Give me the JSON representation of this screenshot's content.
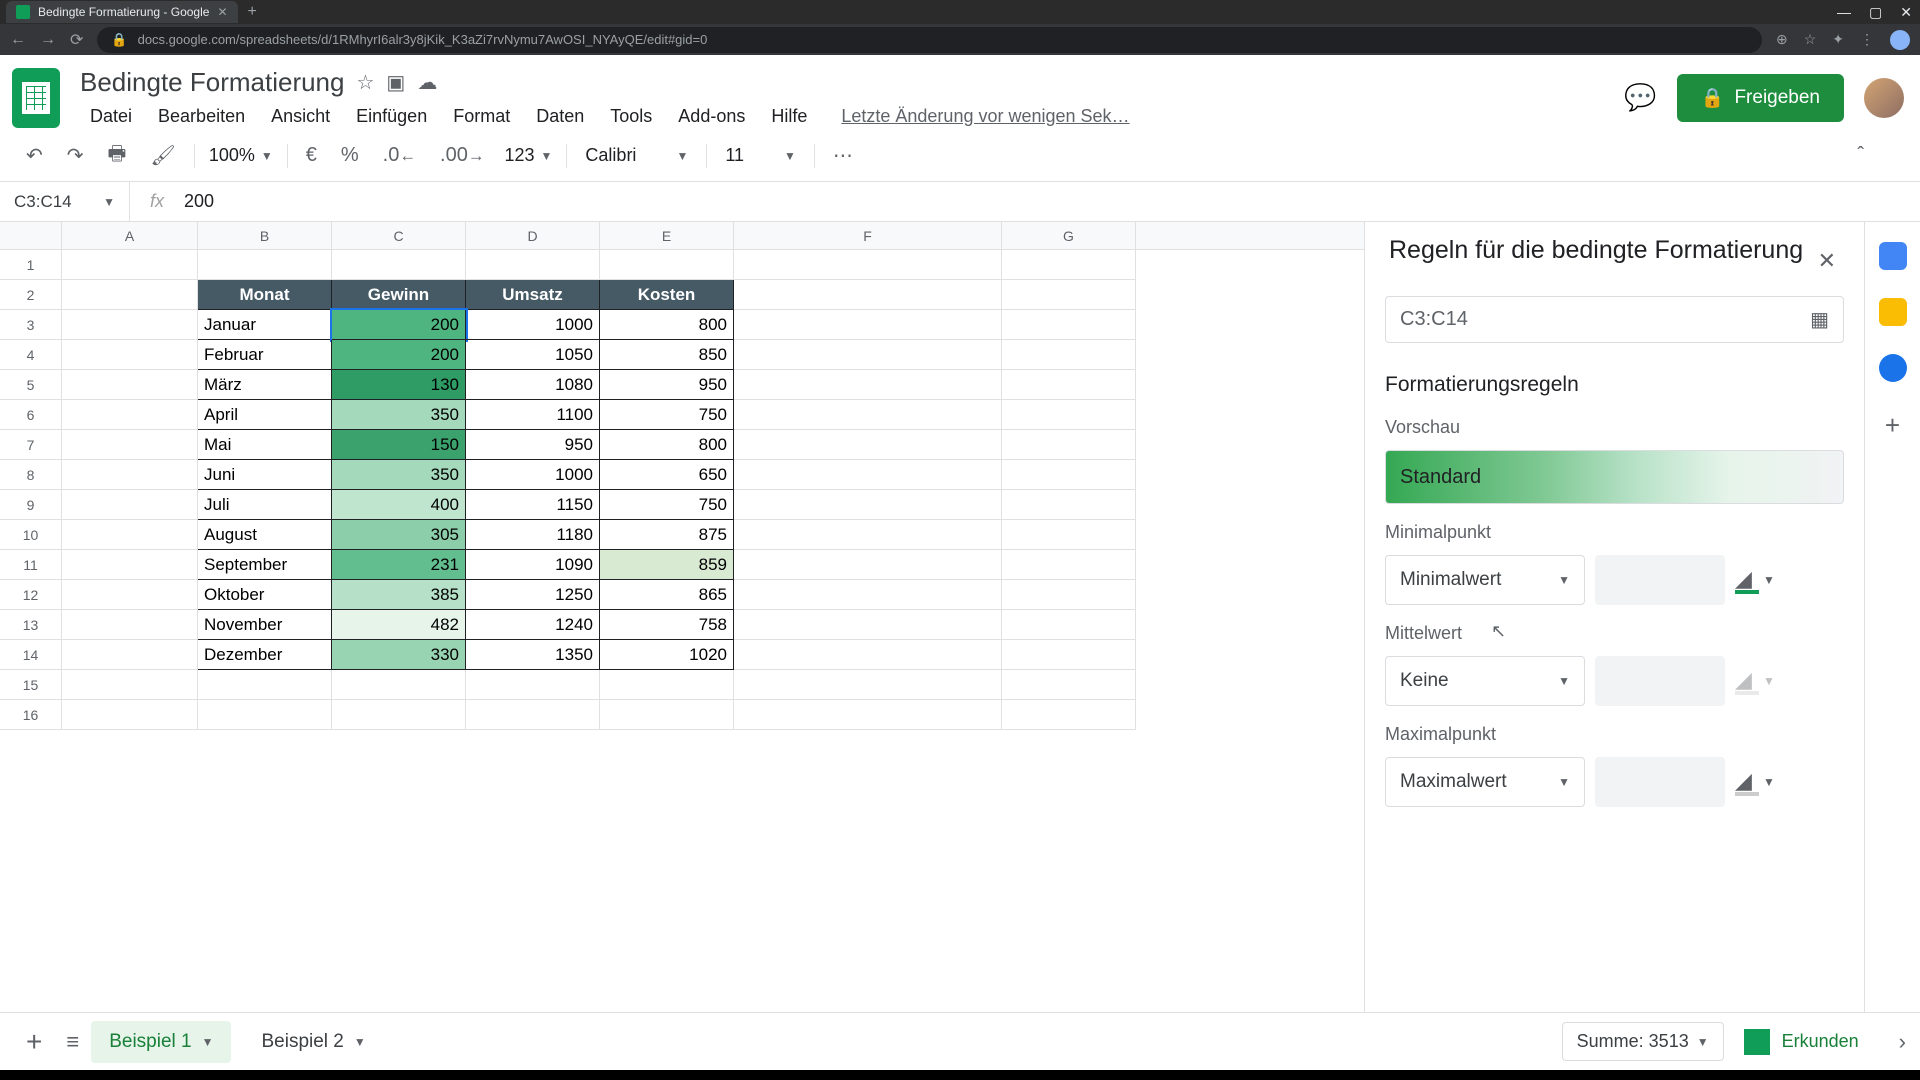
{
  "browser": {
    "tab_title": "Bedingte Formatierung - Google",
    "url": "docs.google.com/spreadsheets/d/1RMhyrI6alr3y8jKik_K3aZi7rvNymu7AwOSI_NYAyQE/edit#gid=0"
  },
  "doc": {
    "title": "Bedingte Formatierung",
    "last_edit": "Letzte Änderung vor wenigen Sek…"
  },
  "menu": {
    "datei": "Datei",
    "bearbeiten": "Bearbeiten",
    "ansicht": "Ansicht",
    "einfuegen": "Einfügen",
    "format": "Format",
    "daten": "Daten",
    "tools": "Tools",
    "addons": "Add-ons",
    "hilfe": "Hilfe"
  },
  "share_label": "Freigeben",
  "toolbar": {
    "zoom": "100%",
    "currency": "€",
    "percent": "%",
    "dec_dec": ".0",
    "inc_dec": ".00",
    "num_format": "123",
    "font": "Calibri",
    "fontsize": "11"
  },
  "formula": {
    "name_box": "C3:C14",
    "value": "200"
  },
  "columns": [
    "A",
    "B",
    "C",
    "D",
    "E",
    "F",
    "G"
  ],
  "table": {
    "headers": {
      "b": "Monat",
      "c": "Gewinn",
      "d": "Umsatz",
      "e": "Kosten"
    },
    "rows": [
      {
        "monat": "Januar",
        "gewinn": 200,
        "umsatz": 1000,
        "kosten": 800,
        "color": "#4fb580"
      },
      {
        "monat": "Februar",
        "gewinn": 200,
        "umsatz": 1050,
        "kosten": 850,
        "color": "#4fb580"
      },
      {
        "monat": "März",
        "gewinn": 130,
        "umsatz": 1080,
        "kosten": 950,
        "color": "#2e9c64"
      },
      {
        "monat": "April",
        "gewinn": 350,
        "umsatz": 1100,
        "kosten": 750,
        "color": "#a5d9bc"
      },
      {
        "monat": "Mai",
        "gewinn": 150,
        "umsatz": 950,
        "kosten": 800,
        "color": "#3ba26e"
      },
      {
        "monat": "Juni",
        "gewinn": 350,
        "umsatz": 1000,
        "kosten": 650,
        "color": "#a5d9bc"
      },
      {
        "monat": "Juli",
        "gewinn": 400,
        "umsatz": 1150,
        "kosten": 750,
        "color": "#c0e5cf"
      },
      {
        "monat": "August",
        "gewinn": 305,
        "umsatz": 1180,
        "kosten": 875,
        "color": "#8dceaa"
      },
      {
        "monat": "September",
        "gewinn": 231,
        "umsatz": 1090,
        "kosten": 859,
        "color": "#63be8f",
        "kosten_hl": true
      },
      {
        "monat": "Oktober",
        "gewinn": 385,
        "umsatz": 1250,
        "kosten": 865,
        "color": "#b7e0c8"
      },
      {
        "monat": "November",
        "gewinn": 482,
        "umsatz": 1240,
        "kosten": 758,
        "color": "#e6f4ea"
      },
      {
        "monat": "Dezember",
        "gewinn": 330,
        "umsatz": 1350,
        "kosten": 1020,
        "color": "#99d4b2"
      }
    ]
  },
  "sidebar": {
    "title": "Regeln für die bedingte Formatierung",
    "range": "C3:C14",
    "rules_label": "Formatierungsregeln",
    "preview_label": "Vorschau",
    "preview_text": "Standard",
    "min_label": "Minimalpunkt",
    "min_select": "Minimalwert",
    "mid_label": "Mittelwert",
    "mid_select": "Keine",
    "max_label": "Maximalpunkt",
    "max_select": "Maximalwert",
    "colors": {
      "min": "#0f9d58",
      "mid": "#f1f3f4",
      "max": "#f1f3f4"
    }
  },
  "sheets": {
    "tab1": "Beispiel 1",
    "tab2": "Beispiel 2"
  },
  "status": {
    "sum": "Summe: 3513",
    "explore": "Erkunden"
  }
}
